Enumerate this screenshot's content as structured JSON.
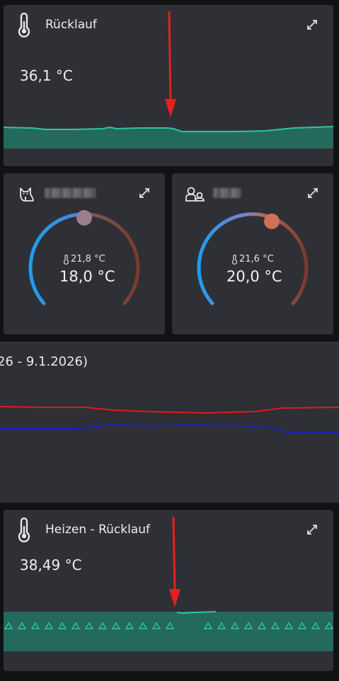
{
  "card1": {
    "title": "Rücklauf",
    "value": "36,1 °C",
    "icon": "thermometer-icon"
  },
  "thermostat_left": {
    "icon": "cat-icon",
    "current": "21,8 °C",
    "target": "18,0 °C"
  },
  "thermostat_right": {
    "icon": "users-icon",
    "current": "21,6 °C",
    "target": "20,0 °C"
  },
  "history_graph": {
    "range_text": "26 - 9.1.2026)",
    "series_colors": [
      "#e41a1a",
      "#1a22c8"
    ]
  },
  "card2": {
    "title": "Heizen - Rücklauf",
    "value": "38,49 °C",
    "icon": "thermometer-icon"
  },
  "colors": {
    "card_bg": "#2f3035",
    "page_bg": "#111214",
    "teal_fill": "#246a5c",
    "teal_line": "#2fc3a4",
    "annotation_arrow": "#e81e1e"
  }
}
